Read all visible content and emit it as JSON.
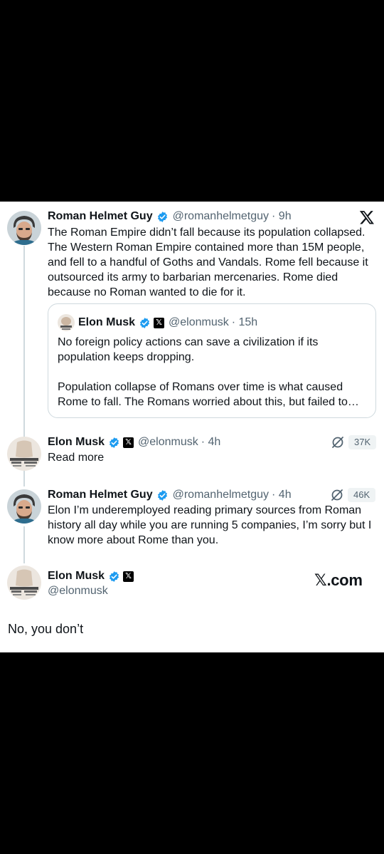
{
  "tweet1": {
    "name": "Roman Helmet Guy",
    "handle": "@romanhelmetguy",
    "time": "· 9h",
    "text": "The Roman Empire didn’t fall because its population collapsed. The Western Roman Empire contained more than 15M people, and fell to a handful of Goths and Vandals. Rome fell because it outsourced its army to barbarian mercenaries. Rome died because no Roman wanted to die for it."
  },
  "quote": {
    "name": "Elon Musk",
    "handle": "@elonmusk",
    "time": "· 15h",
    "text_p1": "No foreign policy actions can save a civilization if its population keeps dropping.",
    "text_p2": "Population collapse of Romans over time is what caused Rome to fall. The Romans worried about this, but failed to…"
  },
  "tweet2": {
    "name": "Elon Musk",
    "handle": "@elonmusk",
    "time": "· 4h",
    "text": "Read more",
    "views": "37K"
  },
  "tweet3": {
    "name": "Roman Helmet Guy",
    "handle": "@romanhelmetguy",
    "time": "· 4h",
    "text": "Elon I’m underemployed reading primary sources from Roman history all day while you are running 5 companies, I’m sorry but I know more about Rome than you.",
    "views": "46K"
  },
  "tweet4": {
    "name": "Elon Musk",
    "handle": "@elonmusk",
    "text": "No, you don’t"
  },
  "branding": {
    "xcom_x": "𝕏",
    "xcom_domain": ".com"
  },
  "icons": {
    "verified": "verified-check-icon",
    "x_badge": "x-affiliate-badge-icon",
    "grok": "grok-icon",
    "x_logo": "x-logo-icon"
  },
  "colors": {
    "verified_blue": "#1d9bf0",
    "text": "#0f1419",
    "secondary": "#536471",
    "border": "#cfd9de"
  }
}
